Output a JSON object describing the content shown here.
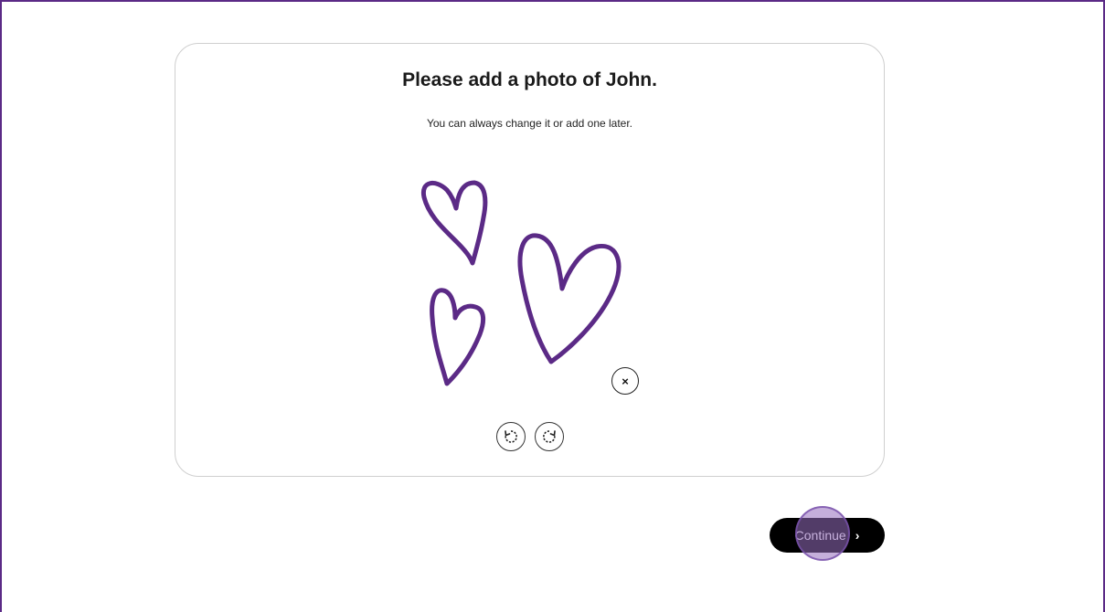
{
  "dialog": {
    "title": "Please add a photo of John.",
    "subtitle": "You can always change it or add one later."
  },
  "photo": {
    "description_icon": "hearts-image",
    "stroke_color": "#5b2a86"
  },
  "controls": {
    "remove_symbol": "×",
    "rotate_left_icon": "rotate-left-icon",
    "rotate_right_icon": "rotate-right-icon"
  },
  "footer": {
    "continue_label": "Continue",
    "continue_chevron": "›"
  },
  "colors": {
    "accent": "#5b2a86",
    "button_bg": "#000000"
  }
}
